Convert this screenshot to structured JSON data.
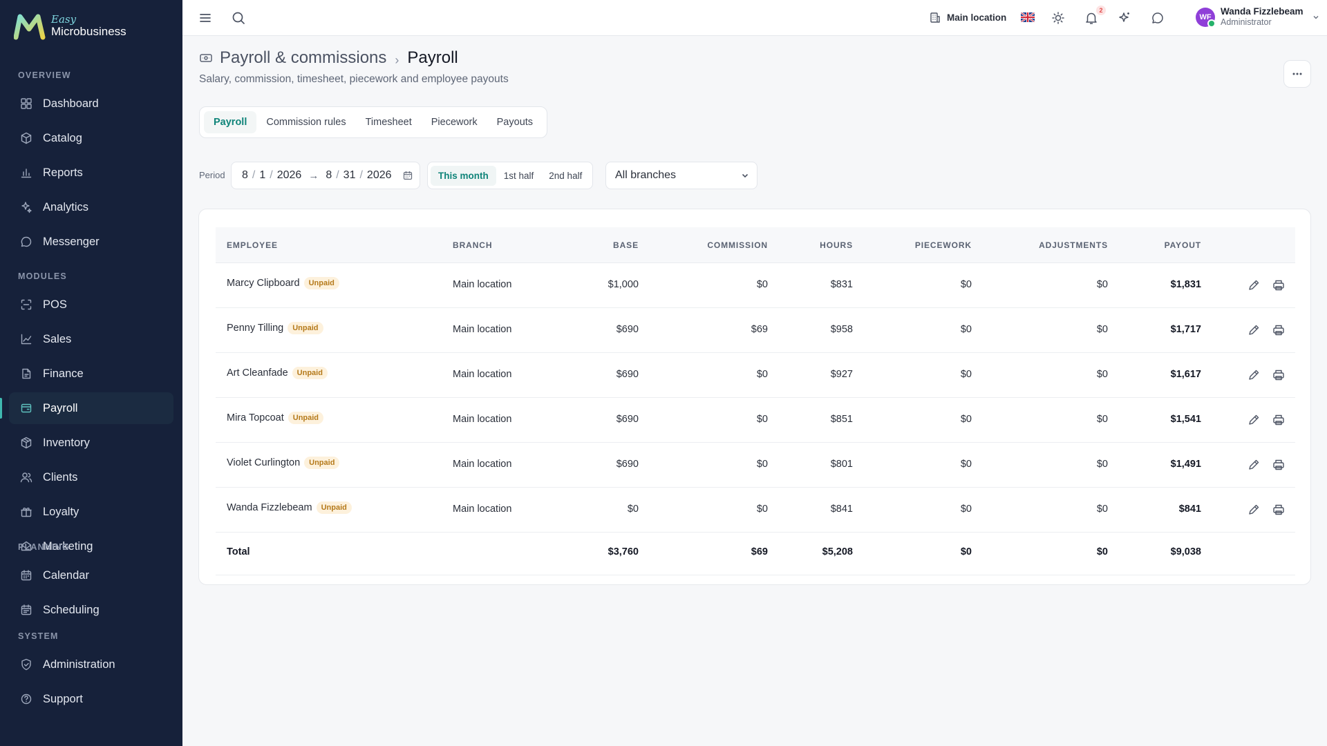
{
  "brand": {
    "easy": "Easy",
    "name": "Microbusiness"
  },
  "sidebar": {
    "sections": [
      {
        "title": "OVERVIEW",
        "items": [
          {
            "label": "Dashboard",
            "icon": "dashboard-icon"
          },
          {
            "label": "Catalog",
            "icon": "catalog-icon"
          },
          {
            "label": "Reports",
            "icon": "reports-icon"
          },
          {
            "label": "Analytics",
            "icon": "analytics-icon"
          },
          {
            "label": "Messenger",
            "icon": "messenger-icon"
          }
        ]
      },
      {
        "title": "MODULES",
        "items": [
          {
            "label": "POS",
            "icon": "pos-icon"
          },
          {
            "label": "Sales",
            "icon": "sales-icon"
          },
          {
            "label": "Finance",
            "icon": "finance-icon"
          },
          {
            "label": "Payroll",
            "icon": "payroll-icon",
            "active": true
          },
          {
            "label": "Inventory",
            "icon": "inventory-icon"
          },
          {
            "label": "Clients",
            "icon": "clients-icon"
          },
          {
            "label": "Loyalty",
            "icon": "loyalty-icon"
          },
          {
            "label": "Marketing",
            "icon": "marketing-icon"
          }
        ]
      },
      {
        "title": "PLANNING",
        "items": [
          {
            "label": "Calendar",
            "icon": "calendar-icon"
          },
          {
            "label": "Scheduling",
            "icon": "scheduling-icon"
          }
        ]
      },
      {
        "title": "SYSTEM",
        "items": [
          {
            "label": "Administration",
            "icon": "administration-icon"
          },
          {
            "label": "Support",
            "icon": "support-icon"
          }
        ]
      }
    ]
  },
  "topbar": {
    "location": "Main location",
    "notification_count": "2",
    "user": {
      "initials": "WF",
      "name": "Wanda Fizzlebeam",
      "role": "Administrator"
    }
  },
  "page": {
    "breadcrumb_parent": "Payroll & commissions",
    "breadcrumb_separator": "›",
    "title": "Payroll",
    "subtitle": "Salary, commission, timesheet, piecework and employee payouts"
  },
  "tabs": [
    {
      "label": "Payroll",
      "active": true
    },
    {
      "label": "Commission rules"
    },
    {
      "label": "Timesheet"
    },
    {
      "label": "Piecework"
    },
    {
      "label": "Payouts"
    }
  ],
  "filters": {
    "period_label": "Period",
    "start": {
      "month": "8",
      "day": "1",
      "year": "2026"
    },
    "end": {
      "month": "8",
      "day": "31",
      "year": "2026"
    },
    "quick": [
      {
        "label": "This month",
        "active": true
      },
      {
        "label": "1st half"
      },
      {
        "label": "2nd half"
      }
    ],
    "branch": "All branches"
  },
  "table": {
    "headers": {
      "employee": "EMPLOYEE",
      "branch": "BRANCH",
      "base": "BASE",
      "commission": "COMMISSION",
      "hours": "HOURS",
      "piecework": "PIECEWORK",
      "adjustments": "ADJUSTMENTS",
      "payout": "PAYOUT"
    },
    "rows": [
      {
        "employee": "Marcy Clipboard",
        "status": "Unpaid",
        "branch": "Main location",
        "base": "$1,000",
        "commission": "$0",
        "hours": "$831",
        "piecework": "$0",
        "adjustments": "$0",
        "payout": "$1,831"
      },
      {
        "employee": "Penny Tilling",
        "status": "Unpaid",
        "branch": "Main location",
        "base": "$690",
        "commission": "$69",
        "hours": "$958",
        "piecework": "$0",
        "adjustments": "$0",
        "payout": "$1,717"
      },
      {
        "employee": "Art Cleanfade",
        "status": "Unpaid",
        "branch": "Main location",
        "base": "$690",
        "commission": "$0",
        "hours": "$927",
        "piecework": "$0",
        "adjustments": "$0",
        "payout": "$1,617"
      },
      {
        "employee": "Mira Topcoat",
        "status": "Unpaid",
        "branch": "Main location",
        "base": "$690",
        "commission": "$0",
        "hours": "$851",
        "piecework": "$0",
        "adjustments": "$0",
        "payout": "$1,541"
      },
      {
        "employee": "Violet Curlington",
        "status": "Unpaid",
        "branch": "Main location",
        "base": "$690",
        "commission": "$0",
        "hours": "$801",
        "piecework": "$0",
        "adjustments": "$0",
        "payout": "$1,491"
      },
      {
        "employee": "Wanda Fizzlebeam",
        "status": "Unpaid",
        "branch": "Main location",
        "base": "$0",
        "commission": "$0",
        "hours": "$841",
        "piecework": "$0",
        "adjustments": "$0",
        "payout": "$841"
      }
    ],
    "total": {
      "label": "Total",
      "base": "$3,760",
      "commission": "$69",
      "hours": "$5,208",
      "piecework": "$0",
      "adjustments": "$0",
      "payout": "$9,038"
    }
  },
  "colors": {
    "sidebar_bg": "#16213a",
    "accent": "#0f8479",
    "unpaid_text": "#b57a1b",
    "unpaid_bg": "#fdf1dc",
    "avatar": "#8f3fd8",
    "online": "#26b26b"
  }
}
